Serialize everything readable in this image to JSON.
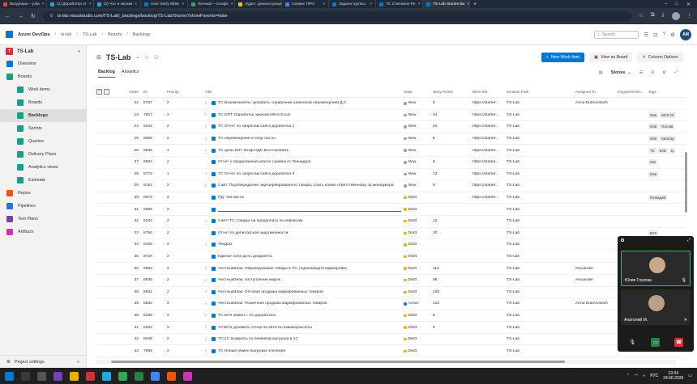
{
  "browser": {
    "tabs": [
      {
        "label": "Входящие – julia",
        "color": "#ea4335"
      },
      {
        "label": "(2) Доработки от",
        "color": "#2aa3e4"
      },
      {
        "label": "(2) Чат и звонки",
        "color": "#2aa3e4"
      },
      {
        "label": "User Story 9556",
        "color": "#0078d4"
      },
      {
        "label": "Личный – Google",
        "color": "#34a853"
      },
      {
        "label": "Аудит: демонстрации",
        "color": "#fbbc05"
      },
      {
        "label": "Сервис ПРО",
        "color": "#4285f4"
      },
      {
        "label": "Задачи группы",
        "color": "#0078d4"
      },
      {
        "label": "ТС Списание Ре",
        "color": "#0078d4"
      },
      {
        "label": "TS-Lab Stories Ba",
        "color": "#0078d4",
        "active": true
      }
    ],
    "url": "ts-lab.visualstudio.com/TS-Lab/_backlogs/backlog/TS-Lab/Stories?showParents=false"
  },
  "header": {
    "product": "Azure DevOps",
    "crumbs": [
      "ts-lab",
      "TS-Lab",
      "Boards",
      "Backlogs"
    ],
    "search_placeholder": "Search",
    "user_initials": "AM"
  },
  "sidebar": {
    "project": {
      "badge": "T",
      "name": "TS-Lab"
    },
    "items": [
      {
        "label": "Overview",
        "icon": "overview-icon",
        "color": "#0078d4",
        "sub": false
      },
      {
        "label": "Boards",
        "icon": "boards-icon",
        "color": "#16a085",
        "sub": false
      },
      {
        "label": "Work items",
        "icon": "work-items-icon",
        "color": "#16a085",
        "sub": true
      },
      {
        "label": "Boards",
        "icon": "board-icon",
        "color": "#16a085",
        "sub": true
      },
      {
        "label": "Backlogs",
        "icon": "backlogs-icon",
        "color": "#16a085",
        "sub": true,
        "selected": true
      },
      {
        "label": "Sprints",
        "icon": "sprints-icon",
        "color": "#16a085",
        "sub": true
      },
      {
        "label": "Queries",
        "icon": "queries-icon",
        "color": "#16a085",
        "sub": true
      },
      {
        "label": "Delivery Plans",
        "icon": "delivery-plans-icon",
        "color": "#16a085",
        "sub": true
      },
      {
        "label": "Analytics views",
        "icon": "analytics-icon",
        "color": "#16a085",
        "sub": true
      },
      {
        "label": "Estimate",
        "icon": "estimate-icon",
        "color": "#16a085",
        "sub": true
      },
      {
        "label": "Repos",
        "icon": "repos-icon",
        "color": "#e8590c",
        "sub": false
      },
      {
        "label": "Pipelines",
        "icon": "pipelines-icon",
        "color": "#2f6fdb",
        "sub": false
      },
      {
        "label": "Test Plans",
        "icon": "test-plans-icon",
        "color": "#7b3fb5",
        "sub": false
      },
      {
        "label": "Artifacts",
        "icon": "artifacts-icon",
        "color": "#c239b3",
        "sub": false
      }
    ],
    "footer": "Project settings"
  },
  "main": {
    "team": "TS-Lab",
    "new_work_item": "New Work Item",
    "view_as_board": "View as Board",
    "column_options": "Column Options",
    "tabs": [
      "Backlog",
      "Analytics"
    ],
    "level": "Stories",
    "columns": [
      "Order",
      "ID",
      "Priority",
      "Title",
      "State",
      "Story Points",
      "Bitrix link",
      "Iteration Path",
      "Assigned To",
      "Original Estim...",
      "Tags"
    ],
    "rows": [
      {
        "order": "22",
        "id": "8767",
        "pri": "2",
        "chev": true,
        "title": "ТС Взаимозачеты: добавить справочник шаблонов перемещений Д.С.",
        "state": "New",
        "sp": "5",
        "bx": "https://starter...",
        "ip": "TS-Lab",
        "at": "Anna Dubrovskikh",
        "tags": []
      },
      {
        "order": "23",
        "id": "7817",
        "pri": "2",
        "chev": true,
        "title": "ТС:ОПТ Обработка заказов ИМ в Excel",
        "state": "New",
        "sp": "24",
        "bx": "https://starter...",
        "ip": "TS-Lab",
        "at": "",
        "tags": [
          "КАБ",
          "МСК От"
        ]
      },
      {
        "order": "24",
        "id": "8444",
        "pri": "2",
        "chev": true,
        "title": "ТС Отчет по запросам сайта доработка 1",
        "state": "New",
        "sp": "20",
        "bx": "https://starter...",
        "ip": "TS-Lab",
        "at": "",
        "tags": [
          "КАБ",
          "Постав"
        ]
      },
      {
        "order": "25",
        "id": "8506",
        "pri": "2",
        "chev": true,
        "title": "ТС перемещения и сбор листы",
        "state": "New",
        "sp": "8",
        "bx": "https://starter...",
        "ip": "TS-Lab",
        "at": "",
        "tags": [
          "КАБ",
          "Категор"
        ]
      },
      {
        "order": "26",
        "id": "8639",
        "pri": "1",
        "chev": true,
        "title": "ТС цены ЮЛ: Коэф НДС восстановить",
        "state": "New",
        "sp": "",
        "bx": "https://starter...",
        "ip": "TS-Lab",
        "at": "",
        "tags": [
          "ТС",
          "КАБ",
          "Ц"
        ]
      },
      {
        "order": "27",
        "id": "8564",
        "pri": "2",
        "chev": false,
        "title": "Отчет о проделанной работе (заявка от Геннадия)",
        "state": "New",
        "sp": "8",
        "bx": "https://starter...",
        "ip": "TS-Lab",
        "at": "",
        "tags": [
          "n8n"
        ]
      },
      {
        "order": "28",
        "id": "8773",
        "pri": "1",
        "chev": true,
        "title": "ТС Отчет по запросам сайта доработка 0",
        "state": "New",
        "sp": "12",
        "bx": "https://starter...",
        "ip": "TS-Lab",
        "at": "",
        "tags": [
          "КАБ"
        ]
      },
      {
        "order": "29",
        "id": "9151",
        "pri": "2",
        "chev": true,
        "title": "Сайт: Подтверждение зарезервированного товара, слать копию ответственному за менеджера",
        "state": "New",
        "sp": "8",
        "bx": "https://starter...",
        "ip": "TS-Lab",
        "at": "",
        "tags": []
      },
      {
        "order": "30",
        "id": "8673",
        "pri": "2",
        "chev": false,
        "title": "ПД: чек-листы",
        "state": "Draft",
        "sp": "",
        "bx": "https://starter...",
        "ip": "TS-Lab",
        "at": "",
        "tags": [
          "Геннадий"
        ]
      },
      {
        "order": "31",
        "id": "6959",
        "pri": "2",
        "chev": false,
        "title": "",
        "state": "Draft",
        "sp": "",
        "bx": "",
        "ip": "TS-Lab",
        "at": "",
        "tags": [],
        "empty": true
      },
      {
        "order": "32",
        "id": "9234",
        "pri": "2",
        "chev": true,
        "title": "Сайт+ТС: Скидка на предоплату по инвойсам",
        "state": "Draft",
        "sp": "12",
        "bx": "",
        "ip": "TS-Lab",
        "at": "",
        "tags": []
      },
      {
        "order": "33",
        "id": "8754",
        "pri": "2",
        "chev": false,
        "title": "Отчет по дебиторской задолженности",
        "state": "Draft",
        "sp": "20",
        "bx": "",
        "ip": "TS-Lab",
        "at": "",
        "tags": [
          "БУХ"
        ]
      },
      {
        "order": "34",
        "id": "9100",
        "pri": "2",
        "chev": true,
        "title": "ТекДокг",
        "state": "Draft",
        "sp": "",
        "bx": "",
        "ip": "TS-Lab",
        "at": "",
        "tags": []
      },
      {
        "order": "35",
        "id": "8729",
        "pri": "2",
        "chev": false,
        "title": "Единое поле даты документа",
        "state": "Draft",
        "sp": "",
        "bx": "",
        "ip": "TS-Lab",
        "at": "",
        "tags": []
      },
      {
        "order": "36",
        "id": "9053",
        "pri": "2",
        "chev": true,
        "title": "ЧестныйЗнак: Оприходование товара в ТС, подлежащего маркировке",
        "state": "Draft",
        "sp": "112",
        "bx": "",
        "ip": "TS-Lab",
        "at": "Alexander",
        "tags": []
      },
      {
        "order": "37",
        "id": "8830",
        "pri": "2",
        "chev": true,
        "title": "ЧестныйЗнак: поступление марок",
        "state": "Draft",
        "sp": "96",
        "bx": "",
        "ip": "TS-Lab",
        "at": "Alexander",
        "tags": []
      },
      {
        "order": "38",
        "id": "8831",
        "pri": "2",
        "chev": true,
        "title": "ЧестныйЗнак: Оптовая продажа маркированных товаров",
        "state": "Draft",
        "sp": "240",
        "bx": "",
        "ip": "TS-Lab",
        "at": "",
        "tags": []
      },
      {
        "order": "39",
        "id": "8832",
        "pri": "2",
        "chev": true,
        "title": "ЧестныйЗнак: Розничная продажа маркированных товаров",
        "state": "Active",
        "sp": "122",
        "bx": "",
        "ip": "TS-Lab",
        "at": "Anna Dubrovskikh",
        "tags": []
      },
      {
        "order": "40",
        "id": "8330",
        "pri": "2",
        "chev": true,
        "title": "ТС БУХ обмен с 1С доработать",
        "state": "Draft",
        "sp": "5",
        "bx": "",
        "ip": "TS-Lab",
        "at": "",
        "tags": []
      },
      {
        "order": "41",
        "id": "8304",
        "pri": "2",
        "chev": true,
        "title": "ТС\\БУХ добавить отбор по ИНН во взаиморасчеты",
        "state": "Draft",
        "sp": "5",
        "bx": "",
        "ip": "TS-Lab",
        "at": "",
        "tags": []
      },
      {
        "order": "42",
        "id": "8348",
        "pri": "2",
        "chev": true,
        "title": "ТС\\1С возвраты по пейкипер выгрузка в 1С",
        "state": "Draft",
        "sp": "",
        "bx": "",
        "ip": "TS-Lab",
        "at": "",
        "tags": []
      },
      {
        "order": "43",
        "id": "7985",
        "pri": "2",
        "chev": true,
        "title": "ТС Новый обмен выгрузки платежей",
        "state": "Draft",
        "sp": "",
        "bx": "",
        "ip": "TS-Lab",
        "at": "",
        "tags": []
      },
      {
        "order": "44",
        "id": "",
        "pri": "",
        "chev": true,
        "title": "",
        "state": "",
        "sp": "",
        "bx": "",
        "ip": "TS-Lab",
        "at": "",
        "tags": []
      }
    ]
  },
  "call": {
    "p1": "Юлия Глухова",
    "p2": "Анатолий М."
  },
  "taskbar": {
    "time": "13:34",
    "date": "24.06.2026",
    "lang": "РУС"
  },
  "colors": {
    "new": "#a19f9d",
    "draft": "#e8b100",
    "active": "#0078d4"
  }
}
